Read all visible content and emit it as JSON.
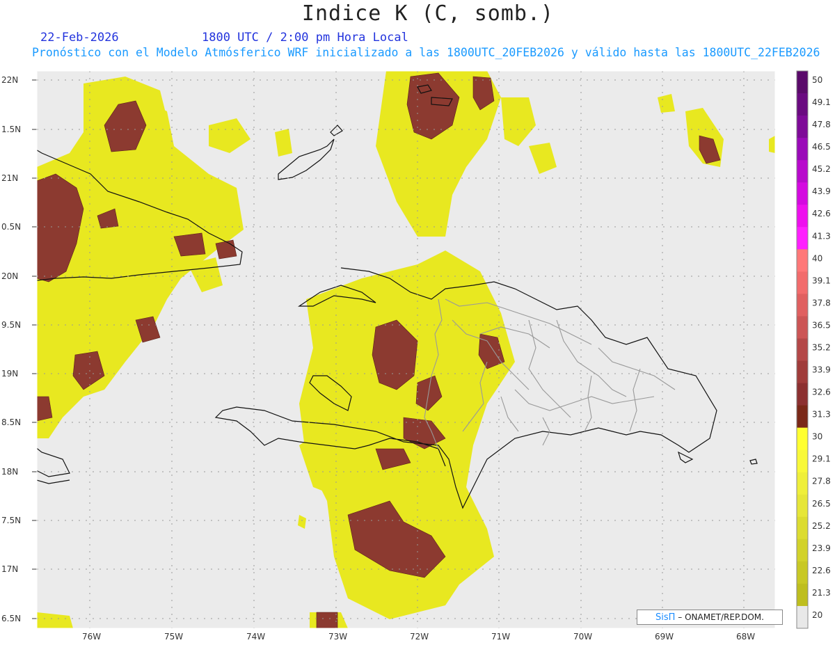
{
  "header": {
    "title": "Indice K (C, somb.)",
    "date": "22-Feb-2026",
    "time": "1800 UTC / 2:00 pm Hora Local",
    "description": "Pronóstico con el Modelo Atmósferico WRF inicializado a las 1800UTC_20FEB2026 y válido hasta las  1800UTC_22FEB2026"
  },
  "map": {
    "lat_labels": [
      "22N",
      "1.5N",
      "21N",
      "0.5N",
      "20N",
      "9.5N",
      "19N",
      "8.5N",
      "18N",
      "7.5N",
      "17N",
      "6.5N"
    ],
    "lon_labels": [
      "76W",
      "75W",
      "74W",
      "73W",
      "72W",
      "71W",
      "70W",
      "69W",
      "68W"
    ],
    "background_color": "#ebebeb"
  },
  "legend": {
    "labels": [
      "50",
      "49.1",
      "47.8",
      "46.5",
      "45.2",
      "43.9",
      "42.6",
      "41.3",
      "40",
      "39.1",
      "37.8",
      "36.5",
      "35.2",
      "33.9",
      "32.6",
      "31.3",
      "30",
      "29.1",
      "27.8",
      "26.5",
      "25.2",
      "23.9",
      "22.6",
      "21.3",
      "20"
    ],
    "colors": [
      "#5a0a6a",
      "#6a0a80",
      "#7e0a98",
      "#9a0ab8",
      "#b80acc",
      "#d40ae0",
      "#ee10ee",
      "#ff20ff",
      "#ff7878",
      "#f26c6c",
      "#e06060",
      "#cc5555",
      "#b44848",
      "#a03c3a",
      "#8c3030",
      "#7a2818",
      "#ffff30",
      "#f8f838",
      "#efef3a",
      "#e6e638",
      "#dcdc30",
      "#d2d22a",
      "#c8c824",
      "#bebe1e",
      "#e8e8e8"
    ]
  },
  "credit": {
    "brand": "SisΠ",
    "text": "– ONAMET/REP.DOM."
  }
}
